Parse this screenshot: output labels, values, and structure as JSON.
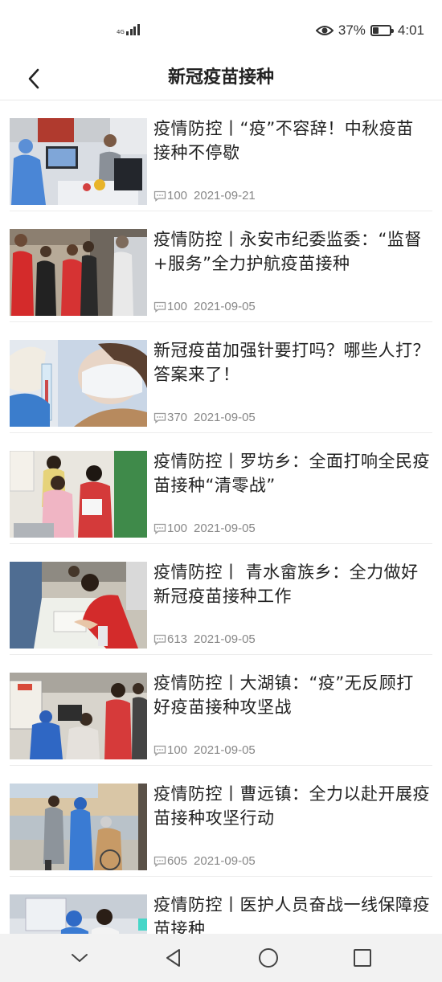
{
  "status_bar": {
    "network": "4G",
    "battery_text": "37%",
    "battery_level": 0.37,
    "time": "4:01"
  },
  "header": {
    "title": "新冠疫苗接种"
  },
  "articles": [
    {
      "title": "疫情防控丨“疫”不容辞！中秋疫苗接种不停歇",
      "comments": "100",
      "date": "2021-09-21",
      "image": "vaccination-desk-photo"
    },
    {
      "title": "疫情防控丨永安市纪委监委：“监督+服务”全力护航疫苗接种",
      "comments": "100",
      "date": "2021-09-05",
      "image": "volunteers-red-vests-photo"
    },
    {
      "title": "新冠疫苗加强针要打吗？哪些人打？答案来了！",
      "comments": "370",
      "date": "2021-09-05",
      "image": "syringe-closeup-photo"
    },
    {
      "title": "疫情防控丨罗坊乡：全面打响全民疫苗接种“清零战”",
      "comments": "100",
      "date": "2021-09-05",
      "image": "child-vaccination-photo"
    },
    {
      "title": "疫情防控丨 青水畲族乡：全力做好新冠疫苗接种工作",
      "comments": "613",
      "date": "2021-09-05",
      "image": "registration-table-photo"
    },
    {
      "title": "疫情防控丨大湖镇：“疫”无反顾打好疫苗接种攻坚战",
      "comments": "100",
      "date": "2021-09-05",
      "image": "medical-staff-home-visit-photo"
    },
    {
      "title": "疫情防控丨曹远镇：全力以赴开展疫苗接种攻坚行动",
      "comments": "605",
      "date": "2021-09-05",
      "image": "outdoor-vaccination-photo"
    },
    {
      "title": "疫情防控丨医护人员奋战一线保障疫苗接种",
      "comments": "",
      "date": "",
      "image": "medical-staff-photo"
    }
  ],
  "system_nav": {
    "icons": [
      "chevron-down-icon",
      "back-triangle-icon",
      "home-circle-icon",
      "recents-square-icon"
    ]
  }
}
